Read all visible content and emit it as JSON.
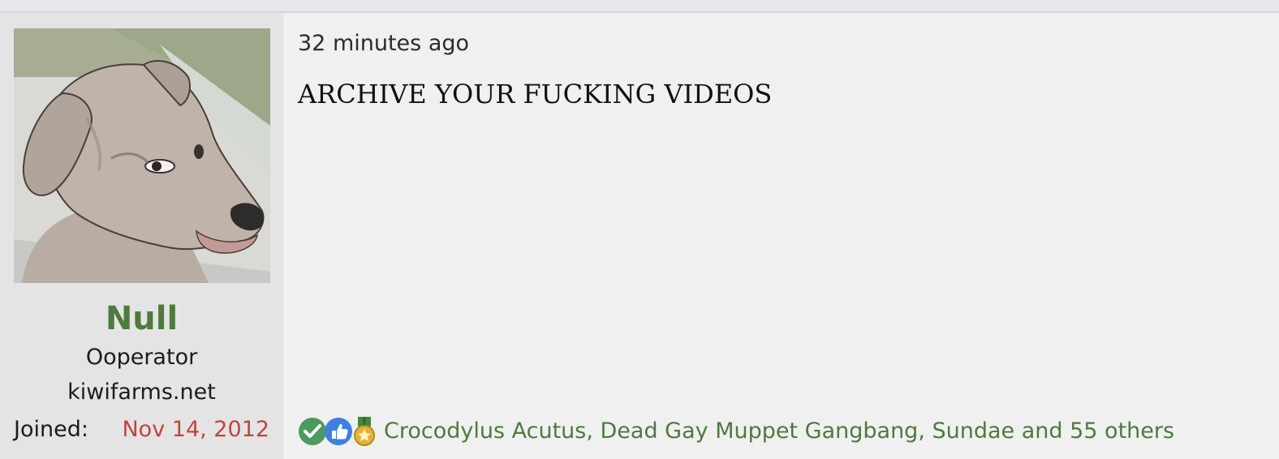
{
  "post": {
    "time_ago": "32 minutes ago",
    "body_text": "ARCHIVE YOUR FUCKING VIDEOS"
  },
  "user": {
    "name": "Null",
    "title": "Ooperator",
    "site": "kiwifarms.net",
    "joined_label": "Joined:",
    "joined_date": "Nov 14, 2012",
    "avatar_icon": "dog-avatar-icon"
  },
  "reactions": {
    "icons": [
      "checkmark-icon",
      "thumbs-up-icon",
      "medal-icon"
    ],
    "users_text": "Crocodylus Acutus, Dead Gay Muppet Gangbang, Sundae and 55 others"
  },
  "colors": {
    "username": "#4e7a3e",
    "joined_date": "#c0453e",
    "reaction_link": "#4e7a3e",
    "panel_bg": "#e4e4e4",
    "post_bg": "#f0f0f0"
  }
}
